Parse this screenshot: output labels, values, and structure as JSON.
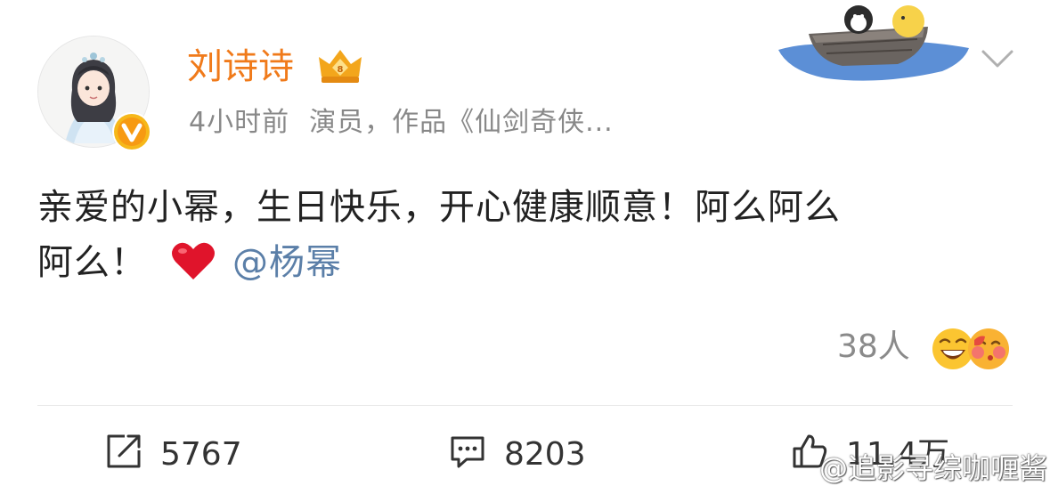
{
  "post": {
    "author": "刘诗诗",
    "time": "4小时前",
    "bio": "演员，作品《仙剑奇侠...",
    "content_line1": "亲爱的小幂，生日快乐，开心健康顺意！阿么阿么",
    "content_line2": "阿么！",
    "mention": "@杨幂",
    "reactions_count": "38人"
  },
  "actions": {
    "repost_count": "5767",
    "comment_count": "8203",
    "like_count": "11.4万"
  },
  "watermark": "@追影寻综咖喱酱",
  "icons": {
    "verified": "verified-v-icon",
    "crown": "crown-badge-icon",
    "chevron": "chevron-down-icon",
    "heart": "red-heart-emoji",
    "repost": "repost-icon",
    "comment": "comment-icon",
    "like": "thumbs-up-icon"
  },
  "colors": {
    "author": "#f07a1a",
    "mention": "#5b7fa8",
    "meta": "#888888",
    "heart": "#e0142b"
  }
}
